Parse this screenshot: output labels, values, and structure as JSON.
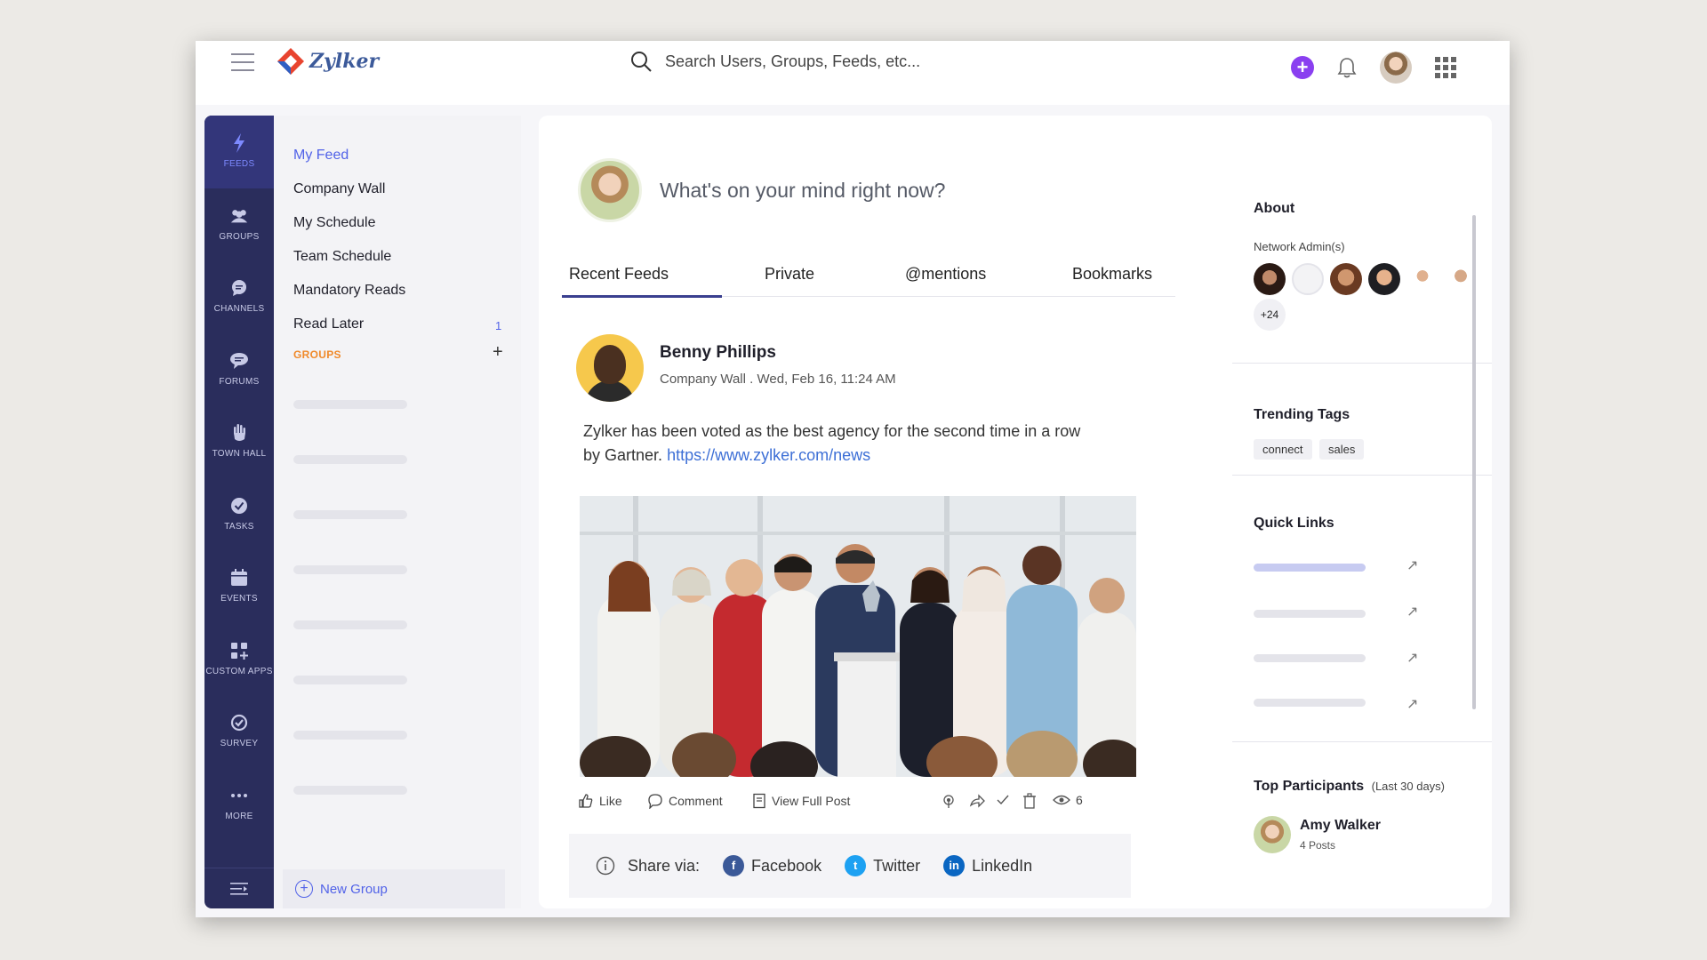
{
  "app": {
    "name": "Zylker"
  },
  "search": {
    "placeholder": "Search Users, Groups, Feeds, etc..."
  },
  "rail": {
    "items": [
      {
        "label": "FEEDS",
        "icon": "bolt-icon"
      },
      {
        "label": "GROUPS",
        "icon": "people-icon"
      },
      {
        "label": "CHANNELS",
        "icon": "chat-bubble-icon"
      },
      {
        "label": "FORUMS",
        "icon": "forum-icon"
      },
      {
        "label": "TOWN HALL",
        "icon": "raised-hand-icon"
      },
      {
        "label": "TASKS",
        "icon": "check-circle-icon"
      },
      {
        "label": "EVENTS",
        "icon": "calendar-icon"
      },
      {
        "label": "CUSTOM APPS",
        "icon": "apps-icon"
      },
      {
        "label": "SURVEY",
        "icon": "survey-icon"
      },
      {
        "label": "MORE",
        "icon": "dots-icon"
      }
    ]
  },
  "subnav": {
    "items": [
      {
        "label": "My Feed"
      },
      {
        "label": "Company Wall"
      },
      {
        "label": "My Schedule"
      },
      {
        "label": "Team Schedule"
      },
      {
        "label": "Mandatory Reads"
      },
      {
        "label": "Read Later",
        "badge": "1"
      }
    ],
    "groups_heading": "GROUPS",
    "groups_add": "+",
    "new_group": "New Group"
  },
  "composer": {
    "placeholder": "What's on your mind right now?"
  },
  "tabs": [
    {
      "label": "Recent Feeds"
    },
    {
      "label": "Private"
    },
    {
      "label": "@mentions"
    },
    {
      "label": "Bookmarks"
    }
  ],
  "post": {
    "author": "Benny Phillips",
    "meta": "Company Wall . Wed, Feb 16, 11:24 AM",
    "text": "Zylker has been voted as the best agency for the second time in a row by Gartner.",
    "link": "https://www.zylker.com/news",
    "actions": {
      "like": "Like",
      "comment": "Comment",
      "view_full": "View Full Post",
      "views": "6"
    },
    "share": {
      "label": "Share via:",
      "facebook": "Facebook",
      "twitter": "Twitter",
      "linkedin": "LinkedIn"
    }
  },
  "right_panel": {
    "about_title": "About",
    "admins_label": "Network Admin(s)",
    "admins_more": "+24",
    "trending_title": "Trending Tags",
    "tags": [
      "connect",
      "sales"
    ],
    "quick_links_title": "Quick Links",
    "top_participants_title": "Top Participants",
    "top_participants_period": "(Last 30 days)",
    "participant": {
      "name": "Amy Walker",
      "posts": "4 Posts"
    }
  },
  "colors": {
    "rail_bg": "#2a2d5c",
    "accent": "#5162e8",
    "groups_heading": "#f08a2b",
    "create_button": "#8a3ff0"
  }
}
